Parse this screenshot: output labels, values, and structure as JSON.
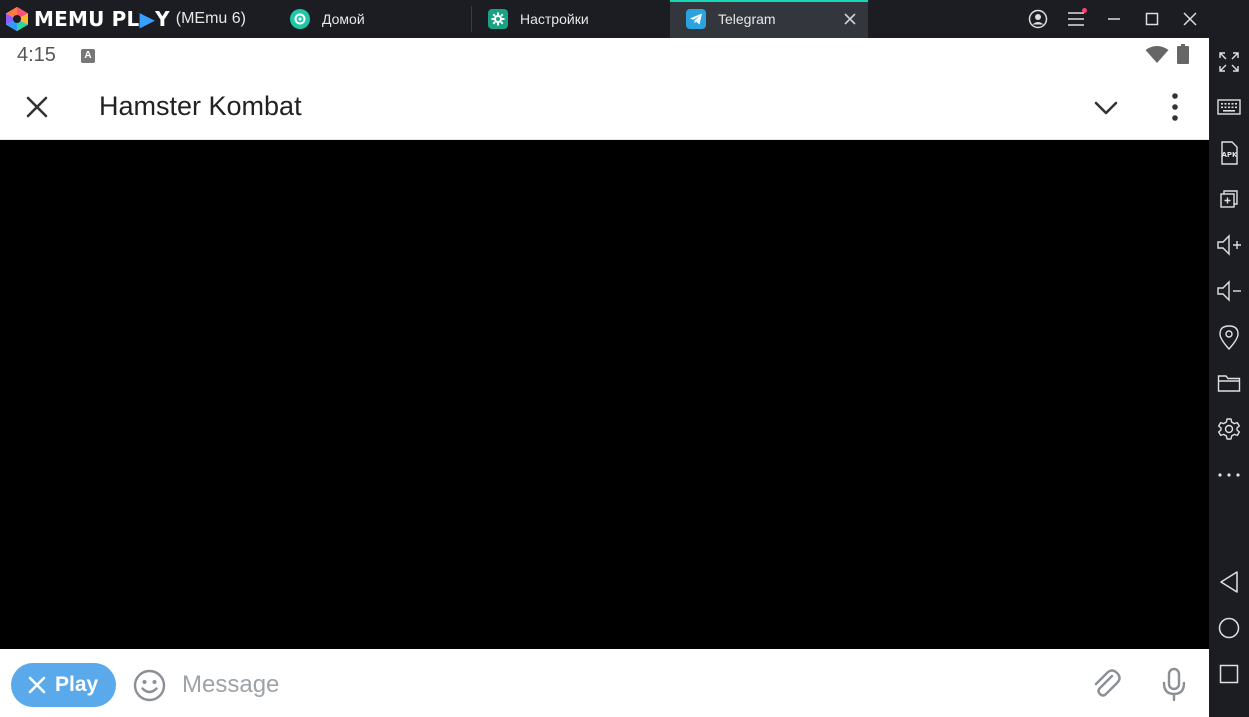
{
  "titlebar": {
    "brand": "MEMU PL",
    "brand_tail": "Y",
    "version": "(MEmu 6)",
    "tabs": [
      {
        "label": "Домой",
        "icon": "home-icon"
      },
      {
        "label": "Настройки",
        "icon": "settings-gear-icon"
      },
      {
        "label": "Telegram",
        "icon": "telegram-icon"
      }
    ],
    "colors": {
      "active_accent": "#16d6b8",
      "badge": "#ff3d6e"
    }
  },
  "statusbar": {
    "time": "4:15",
    "badge": "A"
  },
  "appbar": {
    "title": "Hamster Kombat"
  },
  "inputbar": {
    "play_label": "Play",
    "message_placeholder": "Message",
    "colors": {
      "play_button": "#5aa9ea"
    }
  },
  "sidebar": {
    "items": [
      "fullscreen-icon",
      "keyboard-icon",
      "apk-icon",
      "multi-window-icon",
      "volume-up-icon",
      "volume-down-icon",
      "location-icon",
      "folder-icon",
      "settings-icon",
      "more-icon",
      "back-icon",
      "home-circle-icon",
      "recents-icon"
    ]
  }
}
